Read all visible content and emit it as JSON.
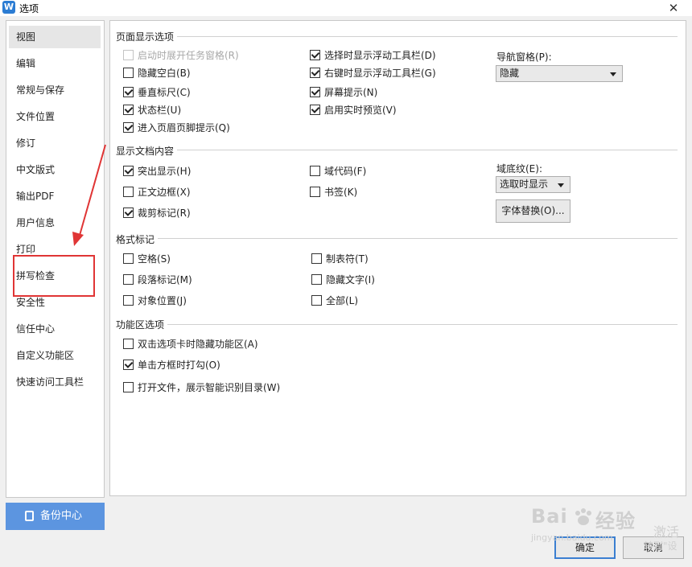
{
  "window": {
    "title": "选项",
    "app_icon_letter": "W",
    "close_glyph": "✕"
  },
  "sidebar": {
    "items": [
      {
        "label": "视图"
      },
      {
        "label": "编辑"
      },
      {
        "label": "常规与保存"
      },
      {
        "label": "文件位置"
      },
      {
        "label": "修订"
      },
      {
        "label": "中文版式"
      },
      {
        "label": "输出PDF"
      },
      {
        "label": "用户信息"
      },
      {
        "label": "打印"
      },
      {
        "label": "拼写检查"
      },
      {
        "label": "安全性"
      },
      {
        "label": "信任中心"
      },
      {
        "label": "自定义功能区"
      },
      {
        "label": "快速访问工具栏"
      }
    ],
    "selected": "视图"
  },
  "backup": {
    "label": "备份中心"
  },
  "sections": {
    "page_display": {
      "title": "页面显示选项",
      "col1": [
        {
          "label": "启动时展开任务窗格(R)",
          "checked": false,
          "disabled": true
        },
        {
          "label": "隐藏空白(B)",
          "checked": false
        },
        {
          "label": "垂直标尺(C)",
          "checked": true
        },
        {
          "label": "状态栏(U)",
          "checked": true
        },
        {
          "label": "进入页眉页脚提示(Q)",
          "checked": true
        }
      ],
      "col2": [
        {
          "label": "选择时显示浮动工具栏(D)",
          "checked": true
        },
        {
          "label": "右键时显示浮动工具栏(G)",
          "checked": true
        },
        {
          "label": "屏幕提示(N)",
          "checked": true
        },
        {
          "label": "启用实时预览(V)",
          "checked": true
        }
      ],
      "nav_pane_label": "导航窗格(P):",
      "nav_pane_value": "隐藏"
    },
    "doc_content": {
      "title": "显示文档内容",
      "col1": [
        {
          "label": "突出显示(H)",
          "checked": true
        },
        {
          "label": "正文边框(X)",
          "checked": false
        },
        {
          "label": "裁剪标记(R)",
          "checked": true
        }
      ],
      "col2": [
        {
          "label": "域代码(F)",
          "checked": false
        },
        {
          "label": "书签(K)",
          "checked": false
        }
      ],
      "field_shading_label": "域底纹(E):",
      "field_shading_value": "选取时显示",
      "font_sub_button": "字体替换(O)..."
    },
    "format_marks": {
      "title": "格式标记",
      "col1": [
        {
          "label": "空格(S)",
          "checked": false
        },
        {
          "label": "段落标记(M)",
          "checked": false
        },
        {
          "label": "对象位置(J)",
          "checked": false
        }
      ],
      "col2": [
        {
          "label": "制表符(T)",
          "checked": false
        },
        {
          "label": "隐藏文字(I)",
          "checked": false
        },
        {
          "label": "全部(L)",
          "checked": false
        }
      ]
    },
    "ribbon": {
      "title": "功能区选项",
      "items": [
        {
          "label": "双击选项卡时隐藏功能区(A)",
          "checked": false
        },
        {
          "label": "单击方框时打勾(O)",
          "checked": true
        },
        {
          "label": "打开文件，展示智能识别目录(W)",
          "checked": false
        }
      ]
    }
  },
  "footer": {
    "ok_label": "确定",
    "cancel_label": "取消"
  },
  "watermark": {
    "brand": "Bai",
    "brand2": "经验",
    "url_fragment": "jingyan.baidu.com",
    "side_text_1": "激活",
    "side_text_2": "转到\"设"
  },
  "colors": {
    "accent": "#5c95e0",
    "annotation": "#e03535",
    "primary_border": "#3b7fd1"
  }
}
